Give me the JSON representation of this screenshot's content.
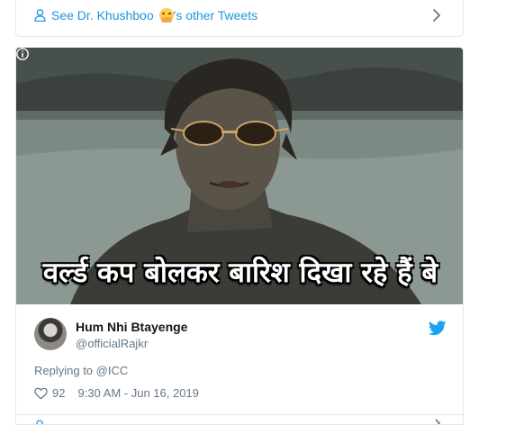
{
  "see_other": {
    "prefix": "See Dr. Khushboo",
    "suffix": "'s other Tweets"
  },
  "media": {
    "caption": "वर्ल्ड कप बोलकर बारिश दिखा रहे हैं बे"
  },
  "tweet": {
    "author_name": "Hum Nhi Btayenge",
    "author_handle": "@officialRajkr",
    "replying_to": "Replying to @ICC",
    "likes": "92",
    "timestamp": "9:30 AM - Jun 16, 2019"
  },
  "colors": {
    "link": "#1b95e0",
    "muted": "#657786",
    "border": "#e1e8ed",
    "twitter_blue": "#1da1f2"
  },
  "icons": [
    "person-icon",
    "face-with-hand-emoji",
    "chevron-right-icon",
    "info-icon",
    "twitter-bird-icon",
    "heart-icon"
  ]
}
